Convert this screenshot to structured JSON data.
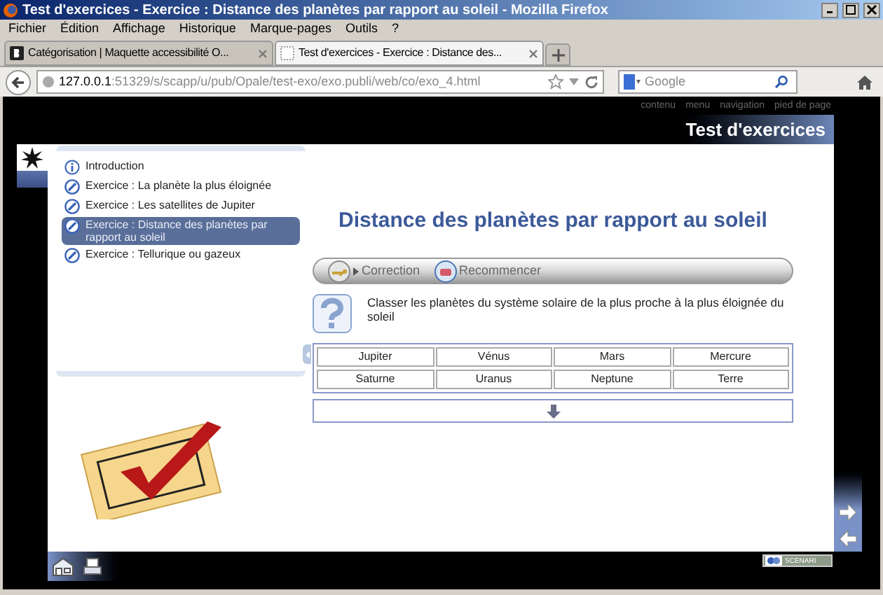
{
  "window": {
    "title": "Test d'exercices - Exercice : Distance des planètes par rapport au soleil - Mozilla Firefox"
  },
  "menu": [
    "Fichier",
    "Édition",
    "Affichage",
    "Historique",
    "Marque-pages",
    "Outils",
    "?"
  ],
  "tabs": [
    {
      "label": "Catégorisation | Maquette accessibilité O...",
      "selected": false
    },
    {
      "label": "Test d'exercices - Exercice : Distance des...",
      "selected": true
    }
  ],
  "address": {
    "host": "127.0.0.1",
    "path": ":51329/s/scapp/u/pub/Opale/test-exo/exo.publi/web/co/exo_4.html"
  },
  "search": {
    "placeholder": "Google"
  },
  "skip_links": [
    "contenu",
    "menu",
    "navigation",
    "pied de page"
  ],
  "header": {
    "title": "Test d'exercices"
  },
  "outline": [
    {
      "label": "Introduction",
      "kind": "intro",
      "selected": false
    },
    {
      "label": "Exercice : La planète la plus éloignée",
      "kind": "exercise",
      "selected": false
    },
    {
      "label": "Exercice : Les satellites de Jupiter",
      "kind": "exercise",
      "selected": false
    },
    {
      "label": "Exercice : Distance des planètes par rapport au soleil",
      "kind": "exercise",
      "selected": true
    },
    {
      "label": "Exercice : Tellurique ou gazeux",
      "kind": "exercise",
      "selected": false
    }
  ],
  "page_title": "Distance des planètes par rapport au soleil",
  "toolbar": [
    {
      "label": "Correction",
      "kind": "key"
    },
    {
      "label": "Recommencer",
      "kind": "reset"
    }
  ],
  "instruction": "Classer les planètes du système solaire de la plus proche à la plus éloignée du soleil",
  "tiles": [
    "Jupiter",
    "Vénus",
    "Mars",
    "Mercure",
    "Saturne",
    "Uranus",
    "Neptune",
    "Terre"
  ],
  "footer": {
    "badge": "SCENARI"
  }
}
